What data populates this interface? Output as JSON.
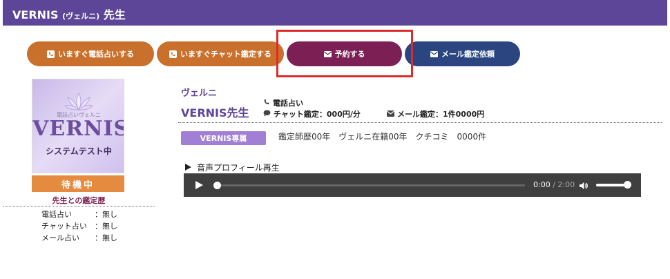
{
  "header": {
    "name": "VERNIS",
    "kana": "(ヴェルニ)",
    "suffix": "先生",
    "bg_color": "#5d4597"
  },
  "buttons": {
    "phone": {
      "label": "いますぐ電話占いする",
      "icon": "phone-icon",
      "color": "#c9712c"
    },
    "chat": {
      "label": "いますぐチャット鑑定する",
      "icon": "phone-icon",
      "color": "#c9712c"
    },
    "reserve": {
      "label": "予約する",
      "icon": "envelope-icon",
      "color": "#7c1f54"
    },
    "mail": {
      "label": "メール鑑定依頼",
      "icon": "envelope-icon",
      "color": "#2a4580"
    }
  },
  "profile_image": {
    "subtitle": "電話占いヴェルニ",
    "logo": "VERNIS",
    "caption": "システムテスト中"
  },
  "status": "待機中",
  "history": {
    "title": "先生との鑑定歴",
    "items": [
      {
        "label": "電話占い",
        "value": "：無し"
      },
      {
        "label": "チャット占い",
        "value": "：無し"
      },
      {
        "label": "メール占い",
        "value": "：無し"
      }
    ]
  },
  "teacher": {
    "kana": "ヴェルニ",
    "name": "VERNIS先生"
  },
  "services": {
    "phone": "電話占い",
    "chat": "チャット鑑定：000円/分",
    "mail": "メール鑑定：1件0000円"
  },
  "badge": "VERNIS専属",
  "career": "鑑定師歴00年　ヴェルニ在籍00年　クチコミ　0000件",
  "voice_profile": {
    "label": "音声プロフィール再生",
    "current_time": "0:00",
    "separator": " / ",
    "total_time": "2:00",
    "progress": 0,
    "volume": 1.0
  }
}
